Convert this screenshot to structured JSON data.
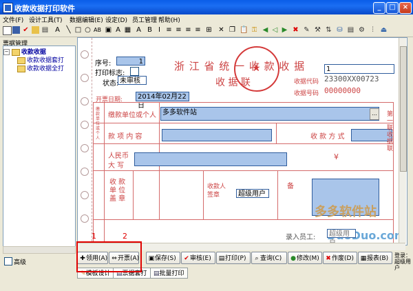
{
  "window": {
    "title": "收款收据打印软件",
    "minimize": "_",
    "maximize": "□",
    "close": "×"
  },
  "menu": [
    "文件(F)",
    "设计工具(T)",
    "数据编辑(E)",
    "设定(D)",
    "员工管理",
    "帮助(H)"
  ],
  "toolbar_icons": [
    "new-icon",
    "save-icon",
    "check-icon",
    "open-icon",
    "print-icon",
    "text-icon",
    "line-icon",
    "rect-icon",
    "ellipse-icon",
    "text-box-icon",
    "image-icon",
    "rich-text-icon",
    "table-icon",
    "variable-icon",
    "delete-icon",
    "copy-icon",
    "paste-icon",
    "undo-icon",
    "redo-icon",
    "grid-icon",
    "key-icon",
    "first-icon",
    "prev-icon",
    "next-icon",
    "last-icon",
    "cancel-icon",
    "edit-icon",
    "tools-icon",
    "align-icon",
    "db-icon",
    "preview-icon",
    "settings-icon",
    "exit-icon"
  ],
  "left_panel": {
    "header": "票据管理",
    "tree": {
      "root": "收款收据",
      "children": [
        "收款收据套打",
        "收款收据全打"
      ]
    },
    "advanced_label": "高级"
  },
  "receipt": {
    "serial_label": "序号:",
    "serial_value": "1",
    "print_flag_label": "打印标志:",
    "status_label": "状态:",
    "status_value": "未审核",
    "title": "浙 江 省 统 一 收 款 收 据",
    "subtitle": "收    据    联",
    "top_right_field": "1",
    "code_label": "收据代码",
    "code_value": "23300XX00723",
    "number_label": "收据号码",
    "number_value": "00000000",
    "date_label": "开票日期:",
    "date_value": "2014年02月22日",
    "payer_label": "缴款单位或个人",
    "payer_value": "多多软件站",
    "item_label": "款 项 内 容",
    "method_label": "收 款 方 式",
    "amount_label_1": "人民币",
    "amount_label_2": "大  写",
    "currency_symbol": "¥",
    "unit_label": "收 款 单 位 盖 章",
    "receiver_label": "收款人签章",
    "receiver_value": "超级用户",
    "note_label": "备",
    "entry_label": "录入员工:",
    "entry_value": "超级用户",
    "side_label": "第一联 收据联",
    "watermark": "多多软件站",
    "watermark_url": "DuoDuo.com"
  },
  "buttons": [
    {
      "label": "领用(A)",
      "icon": "receive-icon"
    },
    {
      "label": "开票(A)",
      "icon": "issue-icon"
    },
    {
      "label": "保存(S)",
      "icon": "save-icon"
    },
    {
      "label": "审核(E)",
      "icon": "audit-icon"
    },
    {
      "label": "打印(P)",
      "icon": "print-icon"
    },
    {
      "label": "查询(C)",
      "icon": "search-icon"
    },
    {
      "label": "修改(M)",
      "icon": "modify-icon"
    },
    {
      "label": "作废(D)",
      "icon": "void-icon"
    },
    {
      "label": "报表(B)",
      "icon": "report-icon"
    }
  ],
  "login_text": "登录：超级用户",
  "tabs": [
    "模板设计",
    "票据套打",
    "批量打印"
  ],
  "annotations": {
    "one": "1",
    "two": "2"
  }
}
